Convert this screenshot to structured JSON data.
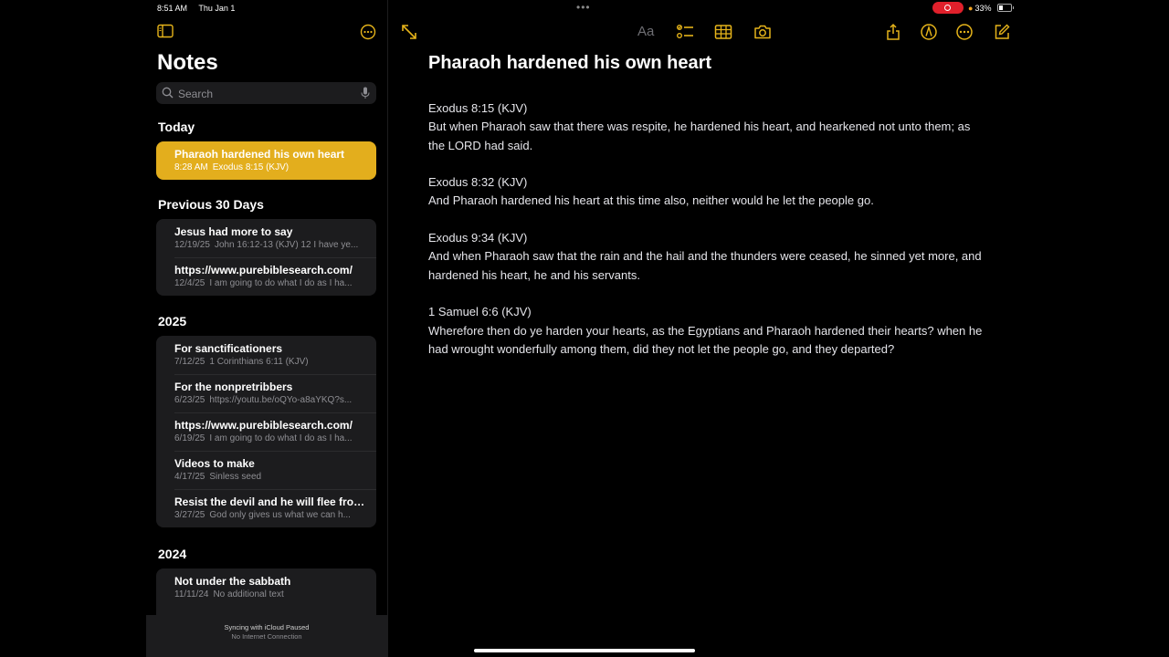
{
  "status": {
    "time": "8:51 AM",
    "date": "Thu Jan 1",
    "battery": "33%"
  },
  "sidebar": {
    "title": "Notes",
    "search_placeholder": "Search",
    "sections": [
      {
        "label": "Today",
        "notes": [
          {
            "title": "Pharaoh hardened his own heart",
            "date": "8:28 AM",
            "preview": "Exodus 8:15 (KJV)",
            "selected": true
          }
        ]
      },
      {
        "label": "Previous 30 Days",
        "notes": [
          {
            "title": "Jesus had more to say",
            "date": "12/19/25",
            "preview": "John 16:12-13 (KJV) 12 I have ye..."
          },
          {
            "title": "https://www.purebiblesearch.com/",
            "date": "12/4/25",
            "preview": "I am going to do what I do as I ha..."
          }
        ]
      },
      {
        "label": "2025",
        "notes": [
          {
            "title": "For sanctificationers",
            "date": "7/12/25",
            "preview": "1 Corinthians 6:11 (KJV)"
          },
          {
            "title": "For the nonpretribbers",
            "date": "6/23/25",
            "preview": "https://youtu.be/oQYo-a8aYKQ?s..."
          },
          {
            "title": "https://www.purebiblesearch.com/",
            "date": "6/19/25",
            "preview": "I am going to do what I do as I ha..."
          },
          {
            "title": "Videos to make",
            "date": "4/17/25",
            "preview": "Sinless seed"
          },
          {
            "title": "Resist the devil and he will flee from...",
            "date": "3/27/25",
            "preview": "God only gives us what we can h..."
          }
        ]
      },
      {
        "label": "2024",
        "notes": [
          {
            "title": "Not under the sabbath",
            "date": "11/11/24",
            "preview": "No additional text"
          }
        ]
      }
    ],
    "sync_status": "Syncing with iCloud Paused",
    "sync_detail": "No Internet Connection"
  },
  "toolbar": {
    "format_label": "Aa",
    "icons": [
      "expand-icon",
      "checklist-icon",
      "table-icon",
      "camera-icon",
      "share-icon",
      "markup-icon",
      "more-icon",
      "compose-icon"
    ]
  },
  "note": {
    "title": "Pharaoh hardened his own heart",
    "paragraphs": [
      {
        "ref": "Exodus 8:15 (KJV)",
        "text": "But when Pharaoh saw that there was respite, he hardened his heart, and hearkened not unto them; as the LORD had said."
      },
      {
        "ref": "Exodus 8:32 (KJV)",
        "text": "And Pharaoh hardened his heart at this time also, neither would he let the people go."
      },
      {
        "ref": "Exodus 9:34 (KJV)",
        "text": "And when Pharaoh saw that the rain and the hail and the thunders were ceased, he sinned yet more, and hardened his heart, he and his servants."
      },
      {
        "ref": "1 Samuel 6:6 (KJV)",
        "text": "Wherefore then do ye harden your hearts, as the Egyptians and Pharaoh hardened their hearts? when he had wrought wonderfully among them, did they not let the people go, and they departed?"
      }
    ]
  },
  "colors": {
    "accent": "#e3ae1d",
    "background": "#000000",
    "card": "#1c1c1e",
    "recording": "#e0202b"
  }
}
